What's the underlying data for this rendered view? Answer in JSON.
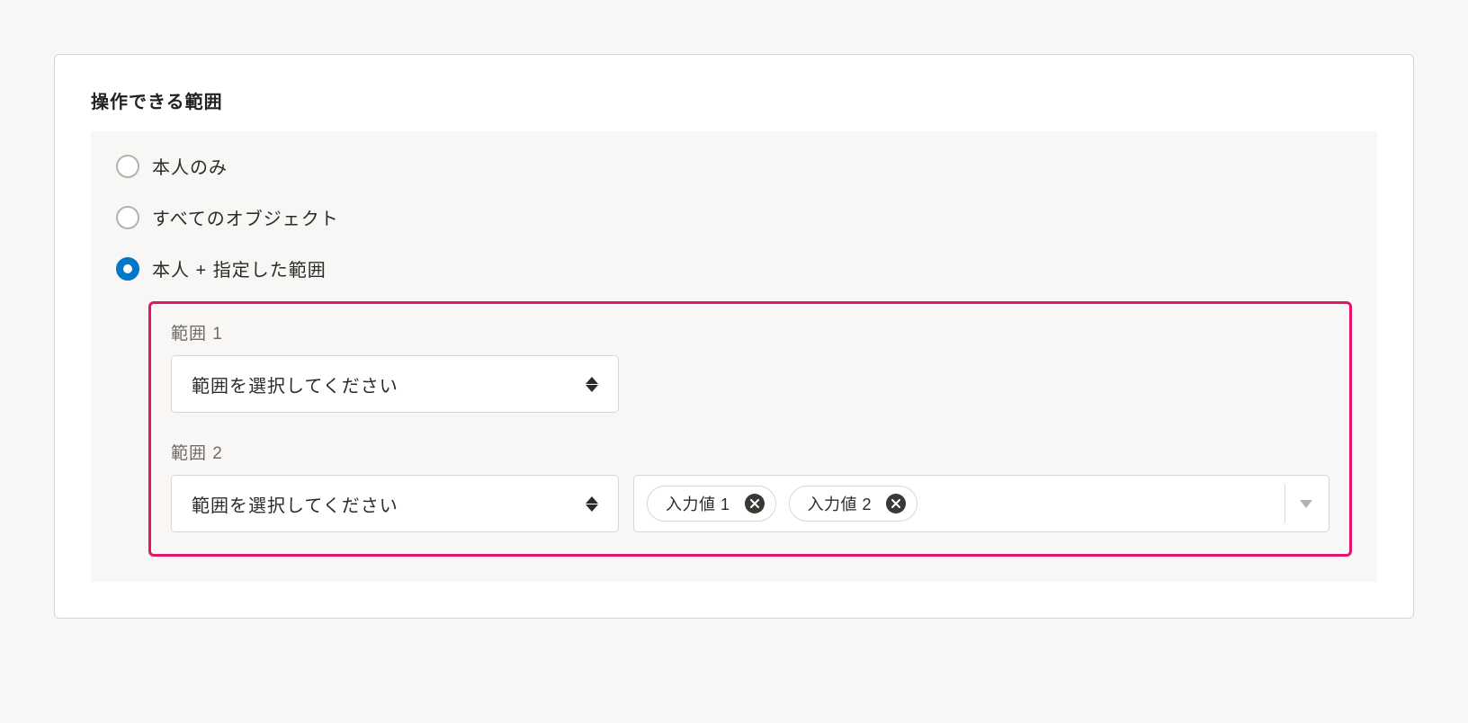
{
  "section": {
    "title": "操作できる範囲"
  },
  "radios": {
    "option1": {
      "label": "本人のみ",
      "selected": false
    },
    "option2": {
      "label": "すべてのオブジェクト",
      "selected": false
    },
    "option3": {
      "label": "本人 + 指定した範囲",
      "selected": true
    }
  },
  "range1": {
    "label": "範囲 1",
    "select": {
      "placeholder": "範囲を選択してください"
    }
  },
  "range2": {
    "label": "範囲 2",
    "select": {
      "placeholder": "範囲を選択してください"
    },
    "tags": {
      "0": {
        "label": "入力値 1"
      },
      "1": {
        "label": "入力値 2"
      }
    }
  }
}
